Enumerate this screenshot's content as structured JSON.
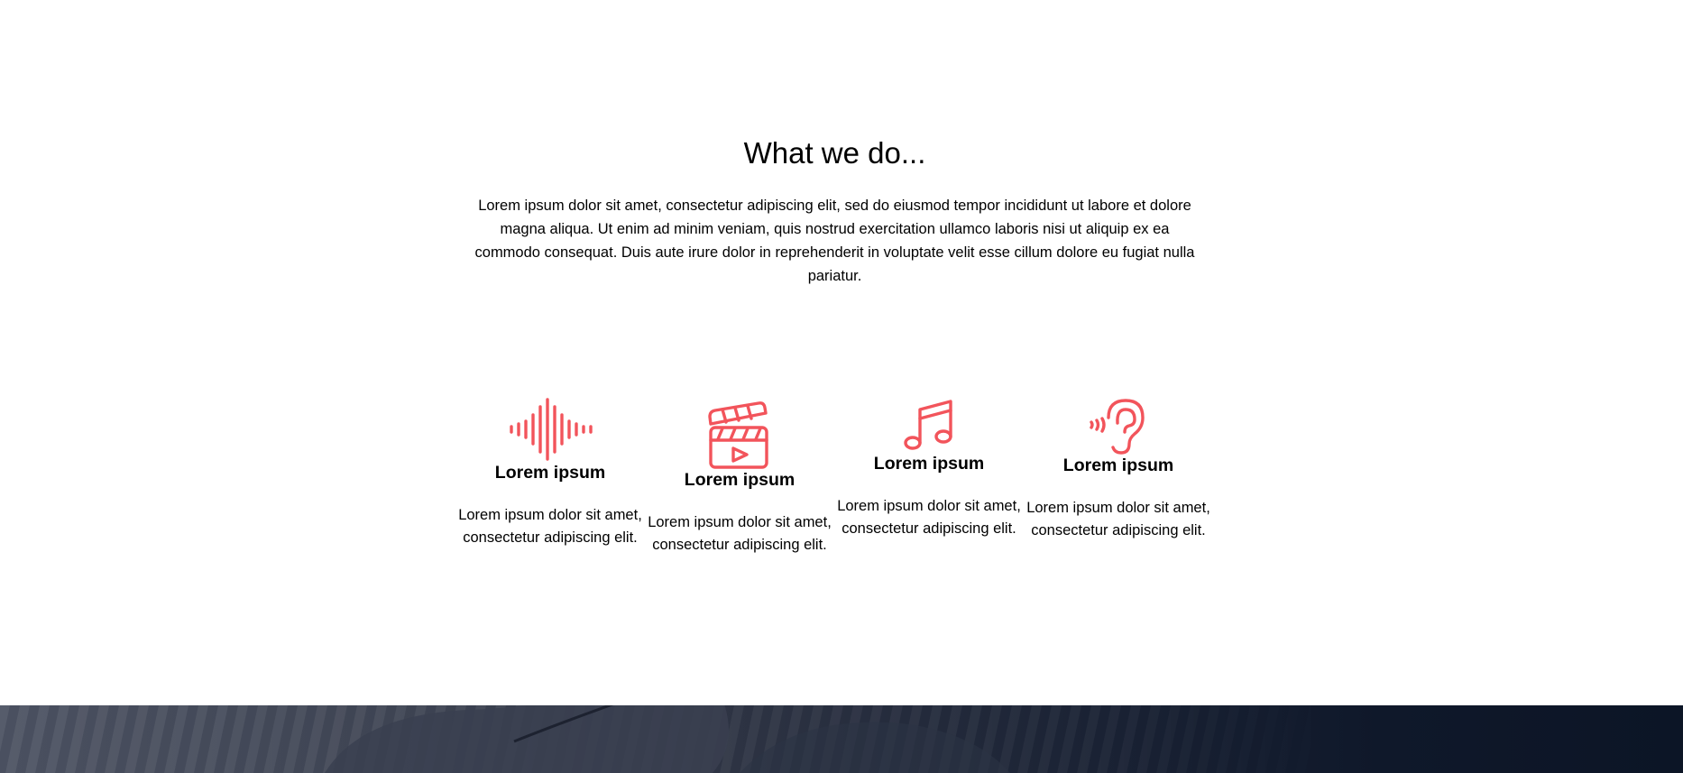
{
  "section": {
    "title": "What we do...",
    "intro": "Lorem ipsum dolor sit amet, consectetur adipiscing elit, sed do eiusmod tempor incididunt ut labore et dolore magna aliqua. Ut enim ad minim veniam, quis nostrud exercitation ullamco laboris nisi ut aliquip ex ea commodo consequat. Duis aute irure dolor in reprehenderit in voluptate velit esse cillum dolore eu fugiat nulla pariatur."
  },
  "accent_color": "#f2545b",
  "services": [
    {
      "icon": "sound-wave-icon",
      "title": "Lorem ipsum",
      "description": "Lorem ipsum dolor sit amet, consectetur adipiscing elit."
    },
    {
      "icon": "clapperboard-icon",
      "title": "Lorem ipsum",
      "description": "Lorem ipsum dolor sit amet, consectetur adipiscing elit."
    },
    {
      "icon": "music-note-icon",
      "title": "Lorem ipsum",
      "description": "Lorem ipsum dolor sit amet, consectetur adipiscing elit."
    },
    {
      "icon": "ear-icon",
      "title": "Lorem ipsum",
      "description": "Lorem ipsum dolor sit amet, consectetur adipiscing elit."
    }
  ]
}
